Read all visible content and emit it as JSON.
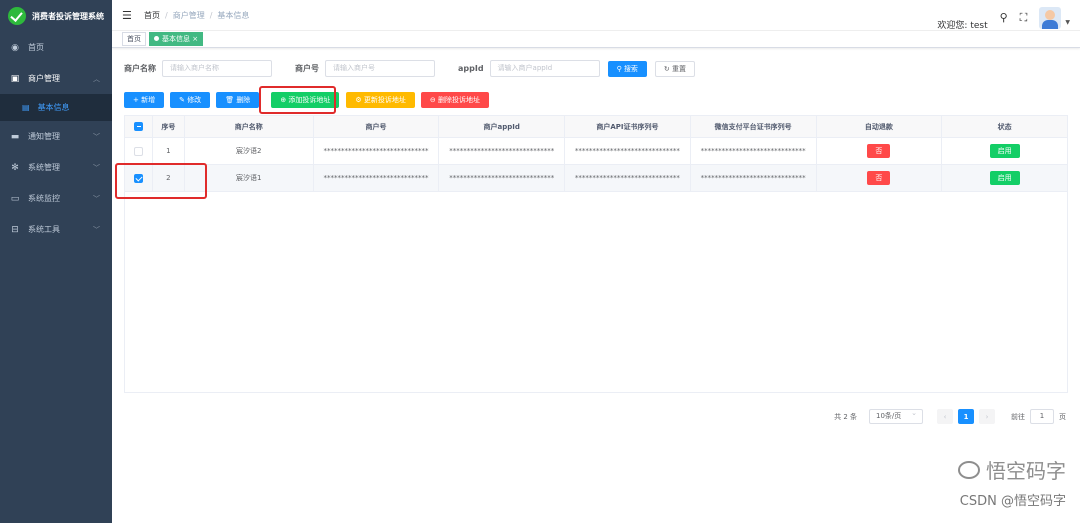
{
  "sidebar": {
    "app_title": "消费者投诉管理系统",
    "items": [
      {
        "label": "首页",
        "icon": "dashboard-icon"
      },
      {
        "label": "商户管理",
        "icon": "shop-icon",
        "expanded": true
      },
      {
        "label": "基本信息",
        "icon": "list-icon",
        "active": true
      },
      {
        "label": "通知管理",
        "icon": "message-icon"
      },
      {
        "label": "系统管理",
        "icon": "gear-icon"
      },
      {
        "label": "系统监控",
        "icon": "monitor-icon"
      },
      {
        "label": "系统工具",
        "icon": "tool-icon"
      }
    ]
  },
  "navbar": {
    "breadcrumb": [
      "首页",
      "商户管理",
      "基本信息"
    ],
    "welcome": "欢迎您: test"
  },
  "tags": {
    "home": "首页",
    "current": "基本信息"
  },
  "search": {
    "merchant_name_label": "商户名称",
    "merchant_name_placeholder": "请输入商户名称",
    "merchant_no_label": "商户号",
    "merchant_no_placeholder": "请输入商户号",
    "appid_label": "appId",
    "appid_placeholder": "请输入商户appId",
    "search_btn": "搜索",
    "reset_btn": "重置"
  },
  "actions": {
    "add": "新增",
    "edit": "修改",
    "delete": "删除",
    "add_complaint_url": "添加投诉地址",
    "update_complaint_url": "更新投诉地址",
    "delete_complaint_url": "删除投诉地址"
  },
  "table": {
    "columns": [
      "序号",
      "商户名称",
      "商户号",
      "商户appId",
      "商户API证书序列号",
      "微信支付平台证书序列号",
      "自动退款",
      "状态"
    ],
    "rows": [
      {
        "index": "1",
        "name": "宸汐语2",
        "mchid": "******************************",
        "appid": "******************************",
        "api_serial": "******************************",
        "platform_serial": "******************************",
        "auto_refund": "否",
        "status": "启用",
        "checked": false
      },
      {
        "index": "2",
        "name": "宸汐语1",
        "mchid": "******************************",
        "appid": "******************************",
        "api_serial": "******************************",
        "platform_serial": "******************************",
        "auto_refund": "否",
        "status": "启用",
        "checked": true
      }
    ]
  },
  "pagination": {
    "total": "共 2 条",
    "page_size": "10条/页",
    "current": "1",
    "goto_label": "前往",
    "goto_value": "1",
    "page_suffix": "页"
  },
  "watermark": {
    "line1": "悟空码字",
    "line2": "CSDN @悟空码字"
  },
  "colors": {
    "sidebar": "#304156",
    "primary": "#1890ff",
    "success": "#13ce66",
    "warning": "#ffba00",
    "danger": "#ff4949",
    "highlight": "#e02b2b"
  }
}
